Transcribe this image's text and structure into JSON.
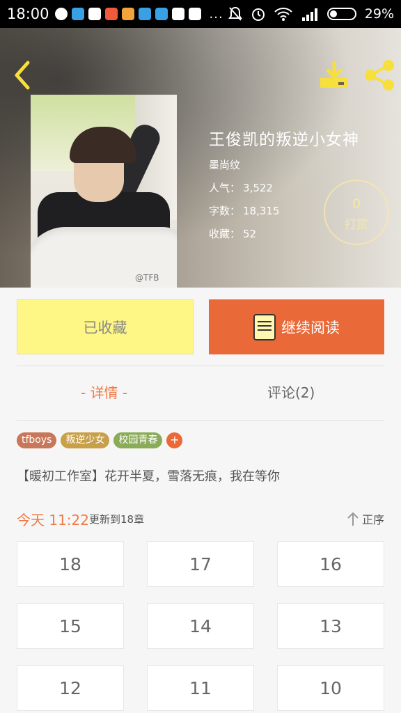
{
  "status_bar": {
    "time": "18:00",
    "dots": "...",
    "battery_percent": "29%"
  },
  "header": {
    "back_icon": "chevron-left-icon",
    "download_icon": "download-icon",
    "share_icon": "share-icon",
    "cover_watermark": "@TFB"
  },
  "book": {
    "title": "王俊凯的叛逆小女神",
    "author": "墨尚纹",
    "popularity_label": "人气：",
    "popularity": "3,522",
    "word_count_label": "字数：",
    "word_count": "18,315",
    "favorites_label": "收藏：",
    "favorites": "52"
  },
  "tip": {
    "count": "0",
    "label": "打赏"
  },
  "actions": {
    "collected_label": "已收藏",
    "continue_label": "继续阅读"
  },
  "tabs": {
    "detail": "- 详情 -",
    "comments": "评论(2)"
  },
  "tags": [
    {
      "label": "tfboys",
      "color": "#c9775b"
    },
    {
      "label": "叛逆少女",
      "color": "#c9a04a"
    },
    {
      "label": "校园青春",
      "color": "#8aab57"
    }
  ],
  "tag_add": "+",
  "intro": "【暖初工作室】花开半夏，雪落无痕，我在等你",
  "update": {
    "time": "今天 11:22",
    "text": "更新到18章",
    "sort_label": "正序"
  },
  "chapters": [
    "18",
    "17",
    "16",
    "15",
    "14",
    "13",
    "12",
    "11",
    "10"
  ],
  "colors": {
    "accent": "#ea6938",
    "collect_bg": "#fef685",
    "tip_ring": "#f7e8a3"
  }
}
